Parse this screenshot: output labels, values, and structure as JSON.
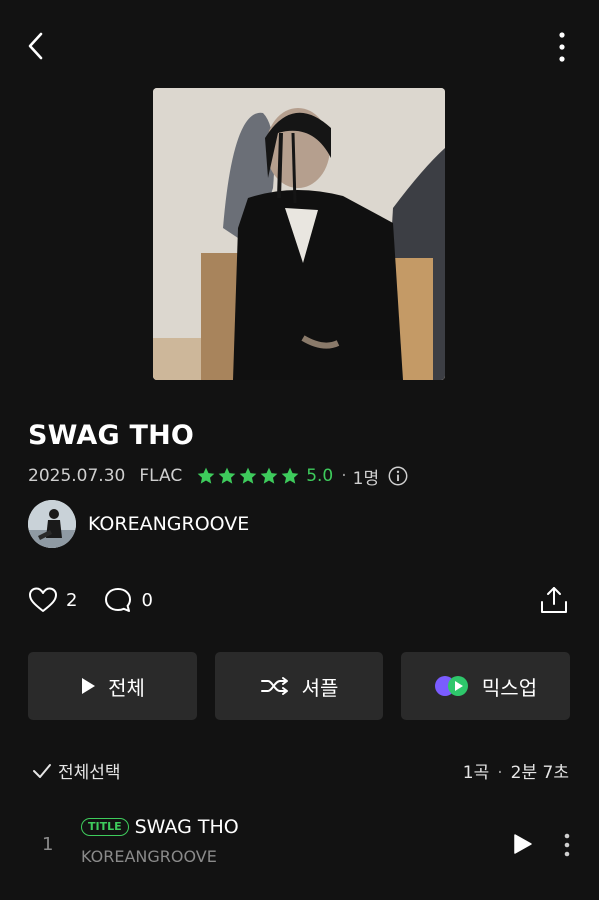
{
  "icons": {
    "back": "chevron-left-icon",
    "more": "vertical-dots-icon",
    "star": "star-icon",
    "info": "info-icon",
    "like": "heart-icon",
    "comment": "comment-icon",
    "share": "share-icon",
    "play": "play-icon",
    "shuffle": "shuffle-icon",
    "mixup": "mixup-icon",
    "check": "check-icon"
  },
  "album": {
    "title": "SWAG THO",
    "release_date": "2025.07.30",
    "format": "FLAC",
    "rating": "5.0",
    "stars": 5,
    "rater_count": "1명",
    "artist": "KOREANGROOVE"
  },
  "stats": {
    "likes": "2",
    "comments": "0"
  },
  "buttons": {
    "play_all": "전체",
    "shuffle": "셔플",
    "mixup": "믹스업"
  },
  "list_header": {
    "select_all": "전체선택",
    "track_count": "1곡",
    "total_duration": "2분 7초"
  },
  "tracks": [
    {
      "number": "1",
      "badge": "TITLE",
      "title": "SWAG THO",
      "artist": "KOREANGROOVE"
    }
  ],
  "colors": {
    "background": "#121212",
    "accent": "#3ecb5c",
    "button_bg": "#2a2a2a"
  }
}
